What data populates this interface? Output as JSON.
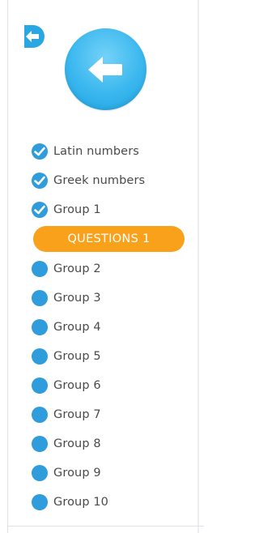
{
  "icons": {
    "exit": "exit-arrow-icon",
    "back": "back-arrow-icon",
    "check": "checkmark-icon"
  },
  "colors": {
    "accent_blue": "#2f9ddb",
    "back_button_blue": "#3ab7ee",
    "active_pill": "#f9a11b",
    "text": "#4a4a4a"
  },
  "nav": {
    "completed": [
      {
        "label": "Latin numbers",
        "status": "done"
      },
      {
        "label": "Greek numbers",
        "status": "done"
      },
      {
        "label": "Group 1",
        "status": "done"
      }
    ],
    "active": {
      "label": "QUESTIONS 1"
    },
    "pending": [
      {
        "label": "Group 2"
      },
      {
        "label": "Group 3"
      },
      {
        "label": "Group 4"
      },
      {
        "label": "Group 5"
      },
      {
        "label": "Group 6"
      },
      {
        "label": "Group 7"
      },
      {
        "label": "Group 8"
      },
      {
        "label": "Group 9"
      },
      {
        "label": "Group 10"
      }
    ]
  }
}
